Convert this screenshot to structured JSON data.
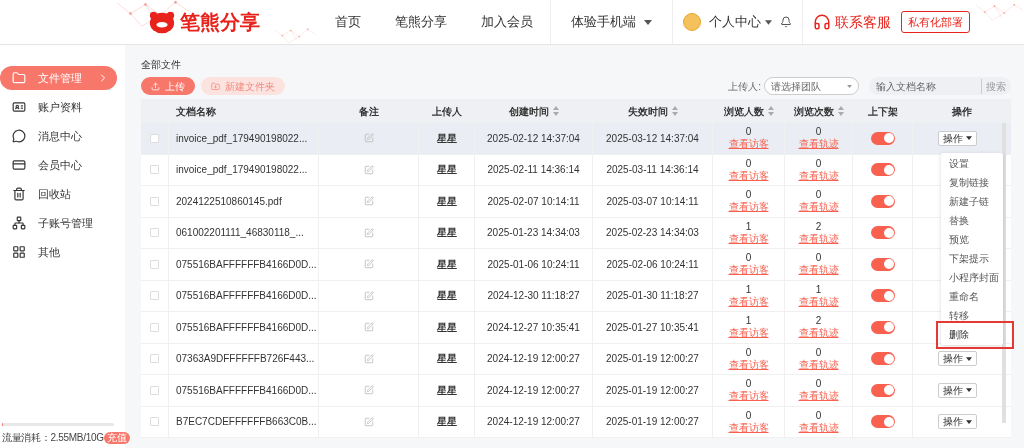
{
  "header": {
    "logo_text": "笔熊分享",
    "nav": [
      {
        "label": "首页",
        "kind": "link"
      },
      {
        "label": "笔熊分享",
        "kind": "link"
      },
      {
        "label": "加入会员",
        "kind": "link"
      },
      {
        "label": "体验手机端",
        "kind": "dropdown"
      }
    ],
    "user_menu": "个人中心",
    "contact": "联系客服",
    "deploy_button": "私有化部署"
  },
  "sidebar": {
    "items": [
      {
        "label": "文件管理",
        "kind": "folder",
        "selected": true
      },
      {
        "label": "账户资料",
        "kind": "id-card",
        "selected": false
      },
      {
        "label": "消息中心",
        "kind": "chat",
        "selected": false
      },
      {
        "label": "会员中心",
        "kind": "card",
        "selected": false
      },
      {
        "label": "回收站",
        "kind": "trash",
        "selected": false
      },
      {
        "label": "子账号管理",
        "kind": "people",
        "selected": false
      },
      {
        "label": "其他",
        "kind": "apps",
        "selected": false
      }
    ],
    "usage": {
      "label": "流量消耗：2.55MB/10G",
      "level": 0.01,
      "badge": "充值"
    }
  },
  "page_title": "全部文件",
  "toolbar": {
    "upload": "上传",
    "new_folder": "新建文件夹",
    "uploader_label": "上传人:",
    "uploader_placeholder": "请选择团队",
    "search_placeholder": "输入文档名称",
    "search_button": "搜索"
  },
  "table": {
    "columns": [
      {
        "sortable": false
      },
      {
        "label": "文档名称",
        "sortable": false
      },
      {
        "label": "备注",
        "sortable": false
      },
      {
        "label": "上传人",
        "sortable": false
      },
      {
        "label": "创建时间",
        "sortable": true
      },
      {
        "label": "失效时间",
        "sortable": true
      },
      {
        "label": "浏览人数",
        "sortable": true
      },
      {
        "label": "浏览次数",
        "sortable": true
      },
      {
        "label": "上下架",
        "sortable": false
      },
      {
        "label": "操作",
        "sortable": false
      }
    ],
    "rows": [
      {
        "checked": false,
        "hovered": true,
        "name": "invoice_pdf_179490198022...",
        "uploader": "星星",
        "created": "2025-02-12 14:37:04",
        "expires": "2025-03-12 14:37:04",
        "visitors": "0",
        "visitors_link": "查看访客",
        "views": "0",
        "views_link": "查看轨迹",
        "on": true,
        "action": "操作"
      },
      {
        "checked": false,
        "hovered": false,
        "name": "invoice_pdf_179490198022...",
        "uploader": "星星",
        "created": "2025-02-11 14:36:14",
        "expires": "2025-03-11 14:36:14",
        "visitors": "0",
        "visitors_link": "查看访客",
        "views": "0",
        "views_link": "查看轨迹",
        "on": true
      },
      {
        "checked": false,
        "hovered": false,
        "name": "2024122510860145.pdf",
        "uploader": "星星",
        "created": "2025-02-07 10:14:11",
        "expires": "2025-03-07 10:14:11",
        "visitors": "0",
        "visitors_link": "查看访客",
        "views": "0",
        "views_link": "查看轨迹",
        "on": true
      },
      {
        "checked": false,
        "hovered": false,
        "name": "061002201111_46830118_...",
        "uploader": "星星",
        "created": "2025-01-23 14:34:03",
        "expires": "2025-02-23 14:34:03",
        "visitors": "1",
        "visitors_link": "查看访客",
        "views": "2",
        "views_link": "查看轨迹",
        "on": true
      },
      {
        "checked": false,
        "hovered": false,
        "name": "075516BAFFFFFFB4166D0D...",
        "uploader": "星星",
        "created": "2025-01-06 10:24:11",
        "expires": "2025-02-06 10:24:11",
        "visitors": "0",
        "visitors_link": "查看访客",
        "views": "0",
        "views_link": "查看轨迹",
        "on": true
      },
      {
        "checked": false,
        "hovered": false,
        "name": "075516BAFFFFFFB4166D0D...",
        "uploader": "星星",
        "created": "2024-12-30 11:18:27",
        "expires": "2025-01-30 11:18:27",
        "visitors": "1",
        "visitors_link": "查看访客",
        "views": "1",
        "views_link": "查看轨迹",
        "on": true
      },
      {
        "checked": false,
        "hovered": false,
        "name": "075516BAFFFFFFB4166D0D...",
        "uploader": "星星",
        "created": "2024-12-27 10:35:41",
        "expires": "2025-01-27 10:35:41",
        "visitors": "1",
        "visitors_link": "查看访客",
        "views": "2",
        "views_link": "查看轨迹",
        "on": true
      },
      {
        "checked": false,
        "hovered": false,
        "name": "07363A9DFFFFFFB726F443...",
        "uploader": "星星",
        "created": "2024-12-19 12:00:27",
        "expires": "2025-01-19 12:00:27",
        "visitors": "0",
        "visitors_link": "查看访客",
        "views": "0",
        "views_link": "查看轨迹",
        "on": true,
        "action": "操作"
      },
      {
        "checked": false,
        "hovered": false,
        "name": "075516BAFFFFFFB4166D0D...",
        "uploader": "星星",
        "created": "2024-12-19 12:00:27",
        "expires": "2025-01-19 12:00:27",
        "visitors": "0",
        "visitors_link": "查看访客",
        "views": "0",
        "views_link": "查看轨迹",
        "on": true,
        "action": "操作"
      },
      {
        "checked": false,
        "hovered": false,
        "name": "B7EC7CDEFFFFFFB663C0B...",
        "uploader": "星星",
        "created": "2024-12-19 12:00:27",
        "expires": "2025-01-19 12:00:27",
        "visitors": "0",
        "visitors_link": "查看访客",
        "views": "0",
        "views_link": "查看轨迹",
        "on": true,
        "action": "操作"
      }
    ]
  },
  "action_menu": {
    "items": [
      {
        "label": "设置",
        "marked": false
      },
      {
        "label": "复制链接",
        "marked": false
      },
      {
        "label": "新建子链",
        "marked": false
      },
      {
        "label": "替换",
        "marked": false
      },
      {
        "label": "预览",
        "marked": false
      },
      {
        "label": "下架提示",
        "marked": false
      },
      {
        "label": "小程序封面",
        "marked": false
      },
      {
        "label": "重命名",
        "marked": false
      },
      {
        "label": "转移",
        "marked": false
      },
      {
        "label": "删除",
        "marked": true
      }
    ]
  }
}
